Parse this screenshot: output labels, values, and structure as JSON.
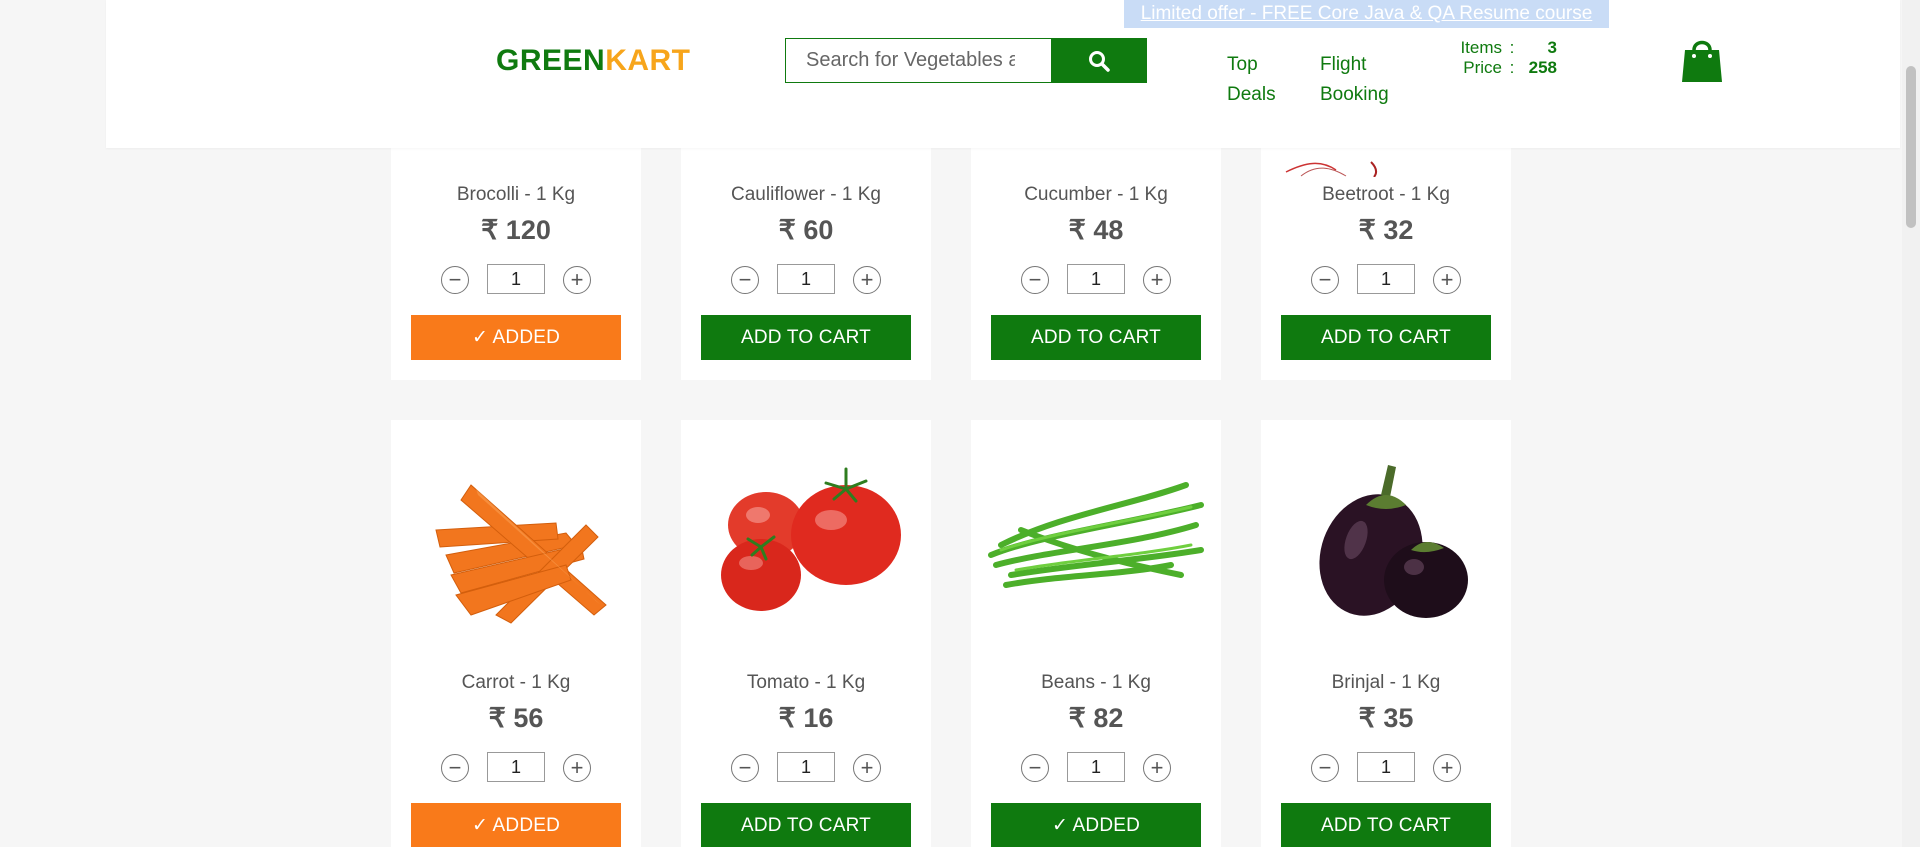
{
  "header": {
    "logo_green": "GREEN",
    "logo_orange": "KART",
    "search_placeholder": "Search for Vegetables and Fruits",
    "nav_top_deals_line1": "Top",
    "nav_top_deals_line2": "Deals",
    "nav_flight_line1": "Flight",
    "nav_flight_line2": "Booking",
    "offer": "Limited offer - FREE Core Java & QA Resume course",
    "cart": {
      "items_label": "Items",
      "items_value": "3",
      "price_label": "Price",
      "price_value": "258",
      "separator": ":"
    }
  },
  "colors": {
    "brand_green": "#0f7a0f",
    "brand_orange": "#f7a51b",
    "added_orange": "#f97a1a"
  },
  "products": [
    {
      "name": "Brocolli - 1 Kg",
      "price": "₹ 120",
      "qty": "1",
      "action": "✓ ADDED",
      "state": "added-orange"
    },
    {
      "name": "Cauliflower - 1 Kg",
      "price": "₹ 60",
      "qty": "1",
      "action": "ADD TO CART",
      "state": "default"
    },
    {
      "name": "Cucumber - 1 Kg",
      "price": "₹ 48",
      "qty": "1",
      "action": "ADD TO CART",
      "state": "default"
    },
    {
      "name": "Beetroot - 1 Kg",
      "price": "₹ 32",
      "qty": "1",
      "action": "ADD TO CART",
      "state": "default"
    },
    {
      "name": "Carrot - 1 Kg",
      "price": "₹ 56",
      "qty": "1",
      "action": "✓ ADDED",
      "state": "added-orange",
      "image": "carrot"
    },
    {
      "name": "Tomato - 1 Kg",
      "price": "₹ 16",
      "qty": "1",
      "action": "ADD TO CART",
      "state": "default",
      "image": "tomato"
    },
    {
      "name": "Beans - 1 Kg",
      "price": "₹ 82",
      "qty": "1",
      "action": "✓ ADDED",
      "state": "added-green",
      "image": "beans"
    },
    {
      "name": "Brinjal - 1 Kg",
      "price": "₹ 35",
      "qty": "1",
      "action": "ADD TO CART",
      "state": "default",
      "image": "brinjal"
    }
  ],
  "stepper": {
    "minus": "−",
    "plus": "+"
  }
}
